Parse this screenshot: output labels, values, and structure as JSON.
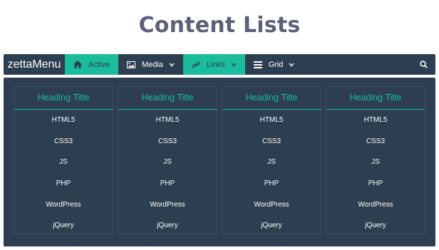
{
  "page": {
    "title": "Content Lists"
  },
  "navbar": {
    "brand": "zettaMenu",
    "items": [
      {
        "label": "Active",
        "icon": "home-icon",
        "active": true,
        "dropdown": false
      },
      {
        "label": "Media",
        "icon": "image-icon",
        "active": false,
        "dropdown": true
      },
      {
        "label": "Links",
        "icon": "link-icon",
        "active": true,
        "dropdown": true
      },
      {
        "label": "Grid",
        "icon": "list-icon",
        "active": false,
        "dropdown": true
      }
    ],
    "search_icon": "search-icon"
  },
  "columns": [
    {
      "heading": "Heading Title",
      "items": [
        "HTML5",
        "CSS3",
        "JS",
        "PHP",
        "WordPress",
        "jQuery"
      ]
    },
    {
      "heading": "Heading Title",
      "items": [
        "HTML5",
        "CSS3",
        "JS",
        "PHP",
        "WordPress",
        "jQuery"
      ]
    },
    {
      "heading": "Heading Title",
      "items": [
        "HTML5",
        "CSS3",
        "JS",
        "PHP",
        "WordPress",
        "jQuery"
      ]
    },
    {
      "heading": "Heading Title",
      "items": [
        "HTML5",
        "CSS3",
        "JS",
        "PHP",
        "WordPress",
        "jQuery"
      ]
    }
  ],
  "colors": {
    "navbar_bg": "#2d3e50",
    "accent": "#1abc9c",
    "title": "#5a6178"
  }
}
